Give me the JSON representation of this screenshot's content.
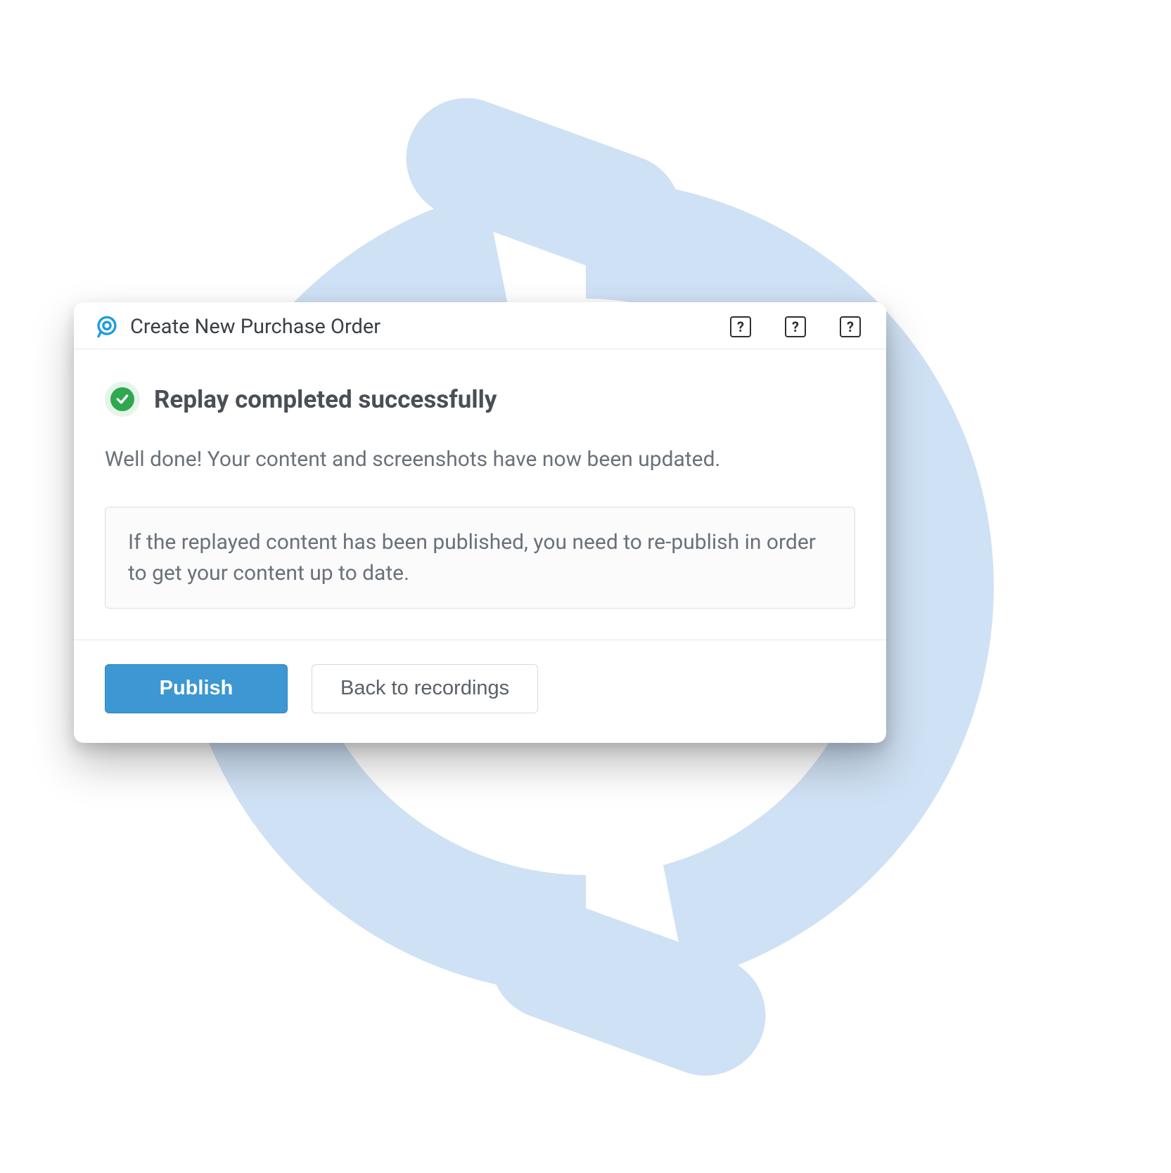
{
  "header": {
    "title": "Create New Purchase Order"
  },
  "status": {
    "heading": "Replay completed successfully",
    "message": "Well done! Your content and screenshots have now been updated."
  },
  "info": {
    "text": "If the replayed content has been published, you need to re-publish in order to get your content up to date."
  },
  "footer": {
    "publish_label": "Publish",
    "back_label": "Back to recordings"
  },
  "colors": {
    "accent_arrow": "#cfe1f4",
    "success": "#2fa84f",
    "primary_btn": "#3d97d3"
  }
}
